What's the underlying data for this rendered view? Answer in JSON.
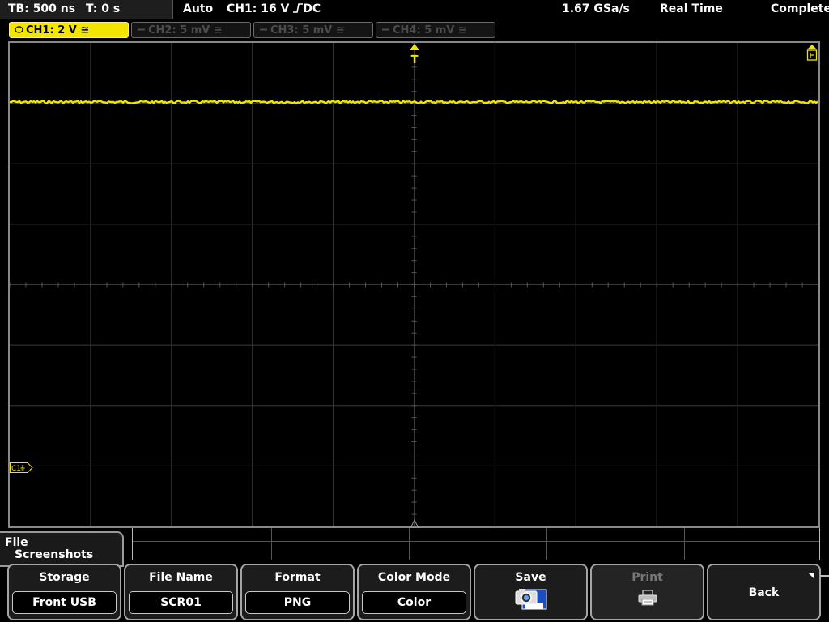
{
  "topbar": {
    "timebase": "TB: 500 ns",
    "trigger_time": "T: 0 s",
    "trigger_mode": "Auto",
    "trigger_source": "CH1: 16 V",
    "trigger_edge_icon": "rising-edge-icon",
    "trigger_coupling": "DC",
    "sample_rate": "1.67 GSa/s",
    "acquisition_mode": "Real Time",
    "acquisition_status": "Complete"
  },
  "channels": [
    {
      "label": "CH1: 2 V",
      "coupling_icon": "≅",
      "active": true,
      "color": "#f2e600"
    },
    {
      "label": "CH2: 5 mV",
      "coupling_icon": "≅",
      "active": false
    },
    {
      "label": "CH3: 5 mV",
      "coupling_icon": "≅",
      "active": false
    },
    {
      "label": "CH4: 5 mV",
      "coupling_icon": "≅",
      "active": false
    }
  ],
  "display": {
    "trigger_marker": "T",
    "channel_marker": "C1",
    "trace_color": "#f2e600",
    "grid_color": "#3a3a3a"
  },
  "menu": {
    "title_line1": "File",
    "title_line2": "Screenshots"
  },
  "softkeys": [
    {
      "label": "Storage",
      "value": "Front USB"
    },
    {
      "label": "File Name",
      "value": "SCR01"
    },
    {
      "label": "Format",
      "value": "PNG"
    },
    {
      "label": "Color Mode",
      "value": "Color"
    },
    {
      "label": "Save",
      "icon": "camera-save-icon"
    },
    {
      "label": "Print",
      "icon": "printer-icon",
      "disabled": true
    },
    {
      "label": "Back"
    }
  ]
}
